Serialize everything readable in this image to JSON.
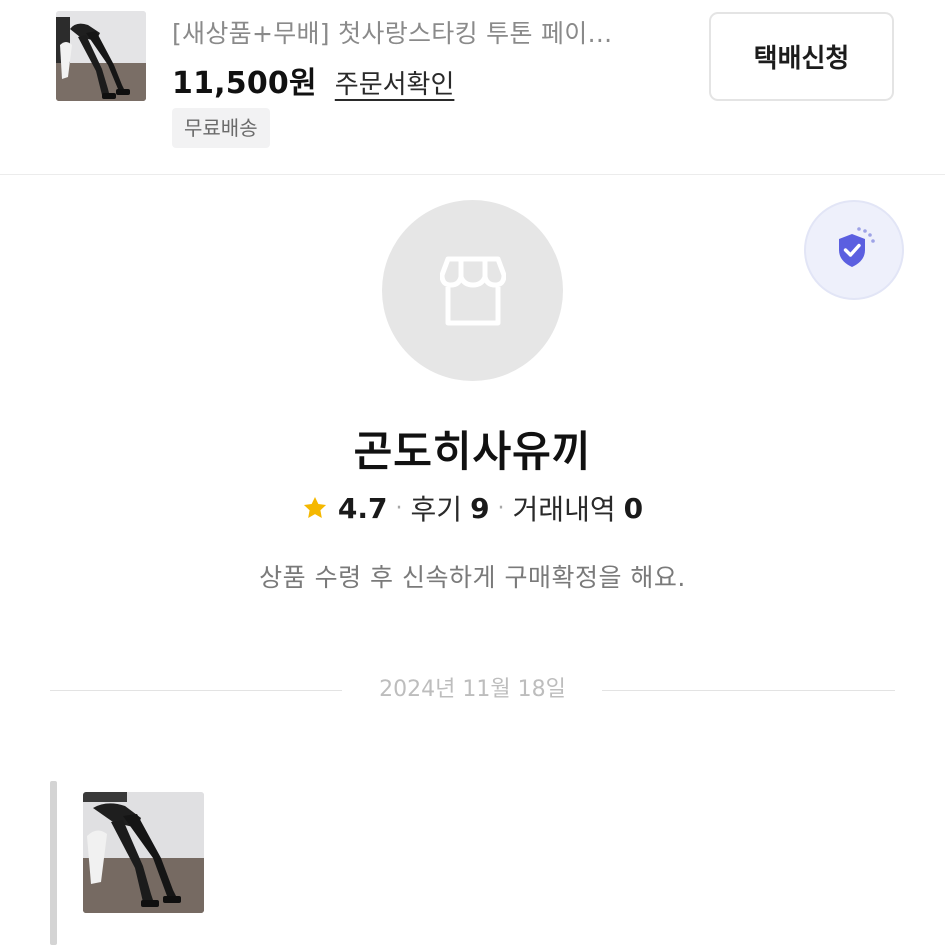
{
  "product": {
    "title": "[새상품+무배] 첫사랑스타킹 투톤 페이...",
    "price": "11,500원",
    "order_link": "주문서확인",
    "badge": "무료배송",
    "delivery_button": "택배신청"
  },
  "shop": {
    "name": "곤도히사유끼",
    "rating": "4.7",
    "review_label": "후기",
    "review_count": "9",
    "trade_label": "거래내역",
    "trade_count": "0",
    "separator": "·",
    "description": "상품 수령 후 신속하게 구매확정을 해요.",
    "shield_color": "#5b5fe0",
    "star_color": "#f5b800"
  },
  "chat": {
    "date": "2024년 11월 18일"
  }
}
